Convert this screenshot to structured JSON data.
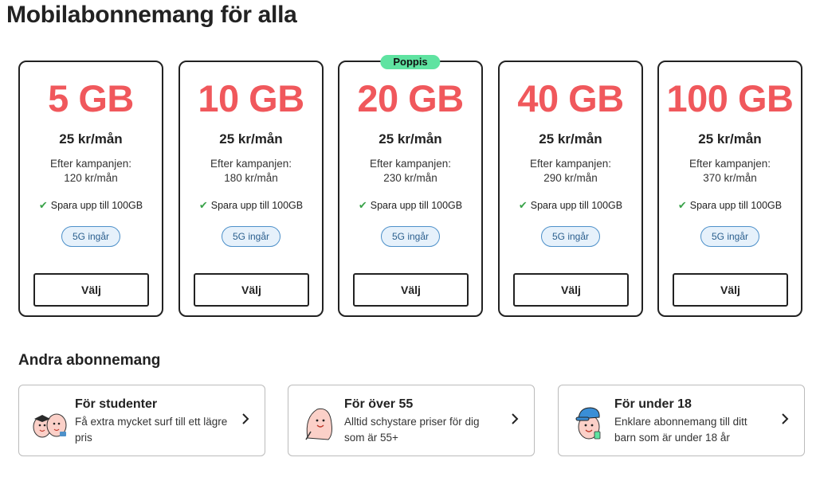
{
  "page_title": "Mobilabonnemang för alla",
  "plans": [
    {
      "data": "5 GB",
      "price": "25 kr/mån",
      "after_label": "Efter kampanjen:",
      "after_price": "120 kr/mån",
      "feature": "Spara upp till 100GB",
      "tag": "5G ingår",
      "button": "Välj",
      "badge": ""
    },
    {
      "data": "10 GB",
      "price": "25 kr/mån",
      "after_label": "Efter kampanjen:",
      "after_price": "180 kr/mån",
      "feature": "Spara upp till 100GB",
      "tag": "5G ingår",
      "button": "Välj",
      "badge": ""
    },
    {
      "data": "20 GB",
      "price": "25 kr/mån",
      "after_label": "Efter kampanjen:",
      "after_price": "230 kr/mån",
      "feature": "Spara upp till 100GB",
      "tag": "5G ingår",
      "button": "Välj",
      "badge": "Poppis"
    },
    {
      "data": "40 GB",
      "price": "25 kr/mån",
      "after_label": "Efter kampanjen:",
      "after_price": "290 kr/mån",
      "feature": "Spara upp till 100GB",
      "tag": "5G ingår",
      "button": "Välj",
      "badge": ""
    },
    {
      "data": "100 GB",
      "price": "25 kr/mån",
      "after_label": "Efter kampanjen:",
      "after_price": "370 kr/mån",
      "feature": "Spara upp till 100GB",
      "tag": "5G ingår",
      "button": "Välj",
      "badge": ""
    }
  ],
  "other": {
    "title": "Andra abonnemang",
    "items": [
      {
        "title": "För studenter",
        "description": "Få extra mycket surf till ett lägre pris",
        "icon": "students-mascot-icon"
      },
      {
        "title": "För över 55",
        "description": "Alltid schystare priser för dig som är 55+",
        "icon": "senior-mascot-icon"
      },
      {
        "title": "För under 18",
        "description": "Enklare abonnemang till ditt barn som är under 18 år",
        "icon": "kid-mascot-icon"
      }
    ]
  },
  "colors": {
    "accent": "#f0585c",
    "badge": "#5fe3a1",
    "check": "#3aa34a",
    "tag_border": "#4d90c9",
    "tag_bg": "#e6f1fb"
  }
}
